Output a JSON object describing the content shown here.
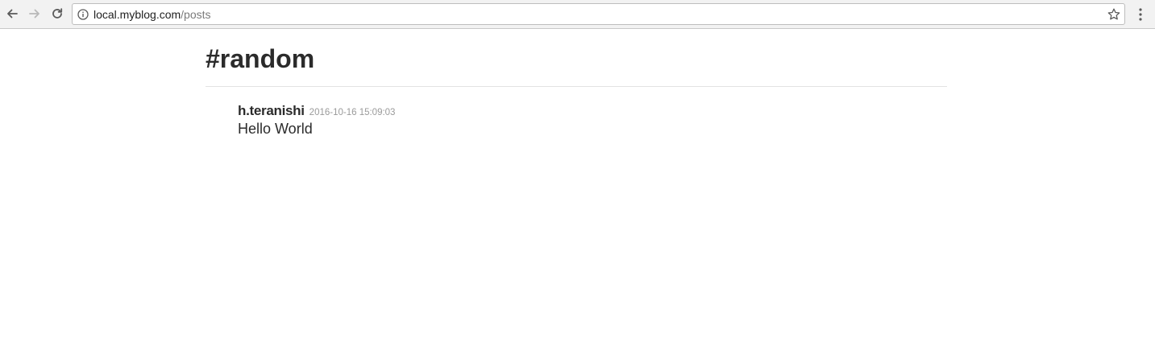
{
  "browser": {
    "url_host": "local.myblog.com",
    "url_path": "/posts",
    "icons": {
      "back": "back-arrow-icon",
      "forward": "forward-arrow-icon",
      "reload": "reload-icon",
      "info": "info-icon",
      "bookmark": "star-icon",
      "menu": "vertical-ellipsis-icon"
    }
  },
  "channel": {
    "title": "#random"
  },
  "posts": [
    {
      "author": "h.teranishi",
      "timestamp": "2016-10-16 15:09:03",
      "body": "Hello World"
    }
  ],
  "colors": {
    "text": "#2b2b2b",
    "muted": "#9a9a9a",
    "divider": "#e3e3e3",
    "toolbar": "#f2f2f2"
  }
}
